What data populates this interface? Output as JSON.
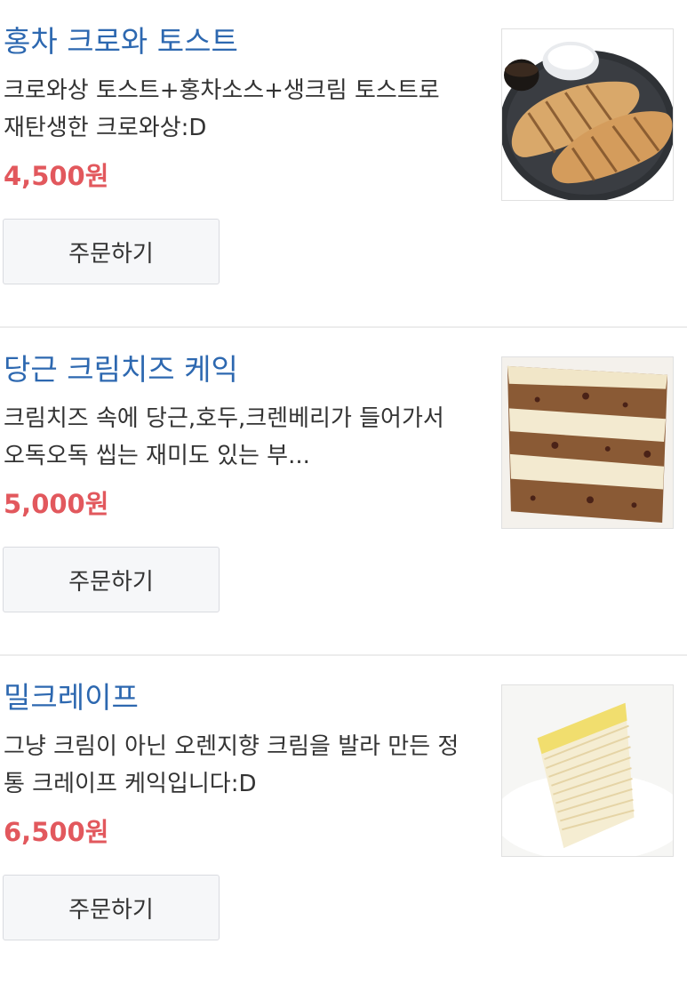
{
  "menu": {
    "order_label": "주문하기",
    "items": [
      {
        "title": "홍차 크로와 토스트",
        "description": "크로와상 토스트+홍차소스+생크림 토스트로 재탄생한 크로와상:D",
        "price": "4,500원",
        "image": "croissant-toast-photo"
      },
      {
        "title": "당근 크림치즈 케익",
        "description": "크림치즈 속에 당근,호두,크렌베리가 들어가서 오독오독 씹는 재미도 있는 부...",
        "price": "5,000원",
        "image": "carrot-cake-photo"
      },
      {
        "title": "밀크레이프",
        "description": "그냥 크림이 아닌 오렌지향 크림을 발라 만든 정통 크레이프 케익입니다:D",
        "price": "6,500원",
        "image": "mille-crepe-photo"
      }
    ]
  }
}
